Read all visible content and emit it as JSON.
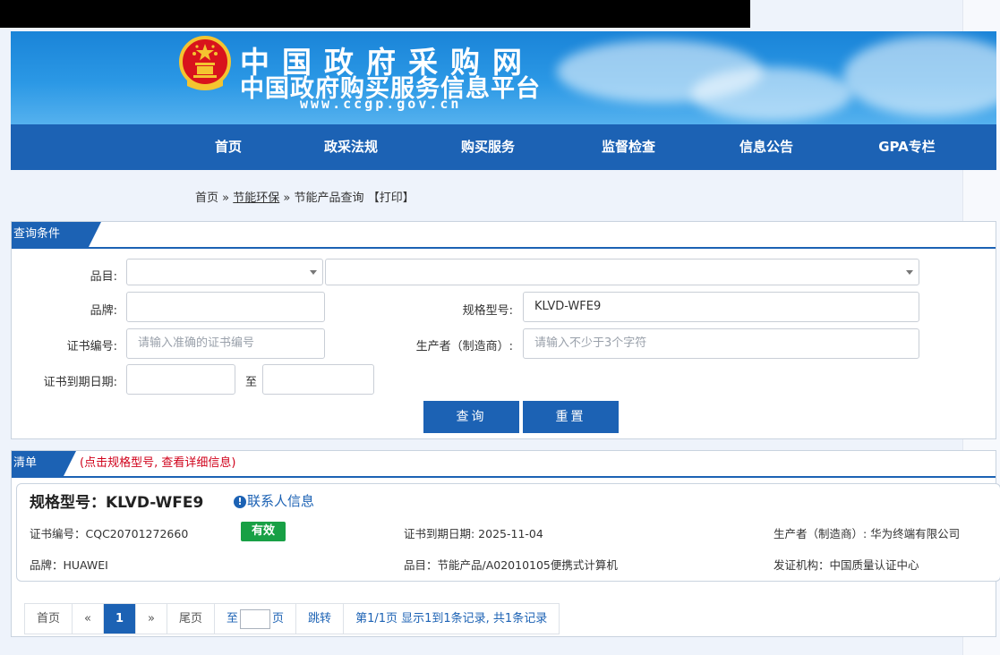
{
  "site": {
    "logo_title": "中国政府采购网",
    "logo_subtitle": "中国政府购买服务信息平台",
    "logo_url": "www.ccgp.gov.cn"
  },
  "nav": [
    "首页",
    "政采法规",
    "购买服务",
    "监督检查",
    "信息公告",
    "GPA专栏"
  ],
  "breadcrumb": {
    "home": "首页",
    "sep": "»",
    "section": "节能环保",
    "current": "节能产品查询",
    "print": "【打印】"
  },
  "query": {
    "tab": "查询条件",
    "category_label": "品目:",
    "brand_label": "品牌:",
    "brand_value": "",
    "model_label": "规格型号:",
    "model_value": "KLVD-WFE9",
    "cert_label": "证书编号:",
    "cert_placeholder": "请输入准确的证书编号",
    "maker_label": "生产者（制造商）:",
    "maker_placeholder": "请输入不少于3个字符",
    "expiry_label": "证书到期日期:",
    "to_label": "至",
    "search_button": "查询",
    "reset_button": "重置"
  },
  "results": {
    "tab": "清单",
    "hint": "(点击规格型号, 查看详细信息)",
    "item": {
      "model": "规格型号：KLVD-WFE9",
      "contact": "联系人信息",
      "cert": "证书编号：CQC20701272660",
      "status": "有效",
      "expiry": "证书到期日期: 2025-11-04",
      "maker": "生产者（制造商）: 华为终端有限公司",
      "brand": "品牌：HUAWEI",
      "category": "品目：节能产品/A02010105便携式计算机",
      "issuer": "发证机构：中国质量认证中心"
    }
  },
  "pager": {
    "first": "首页",
    "prev": "«",
    "current": "1",
    "next": "»",
    "last": "尾页",
    "to": "至",
    "page": "页",
    "jump": "跳转",
    "summary": "第1/1页 显示1到1条记录, 共1条记录"
  },
  "colors": {
    "primary": "#1c62b4",
    "valid_badge": "#18a045",
    "hint": "#d0021b"
  }
}
